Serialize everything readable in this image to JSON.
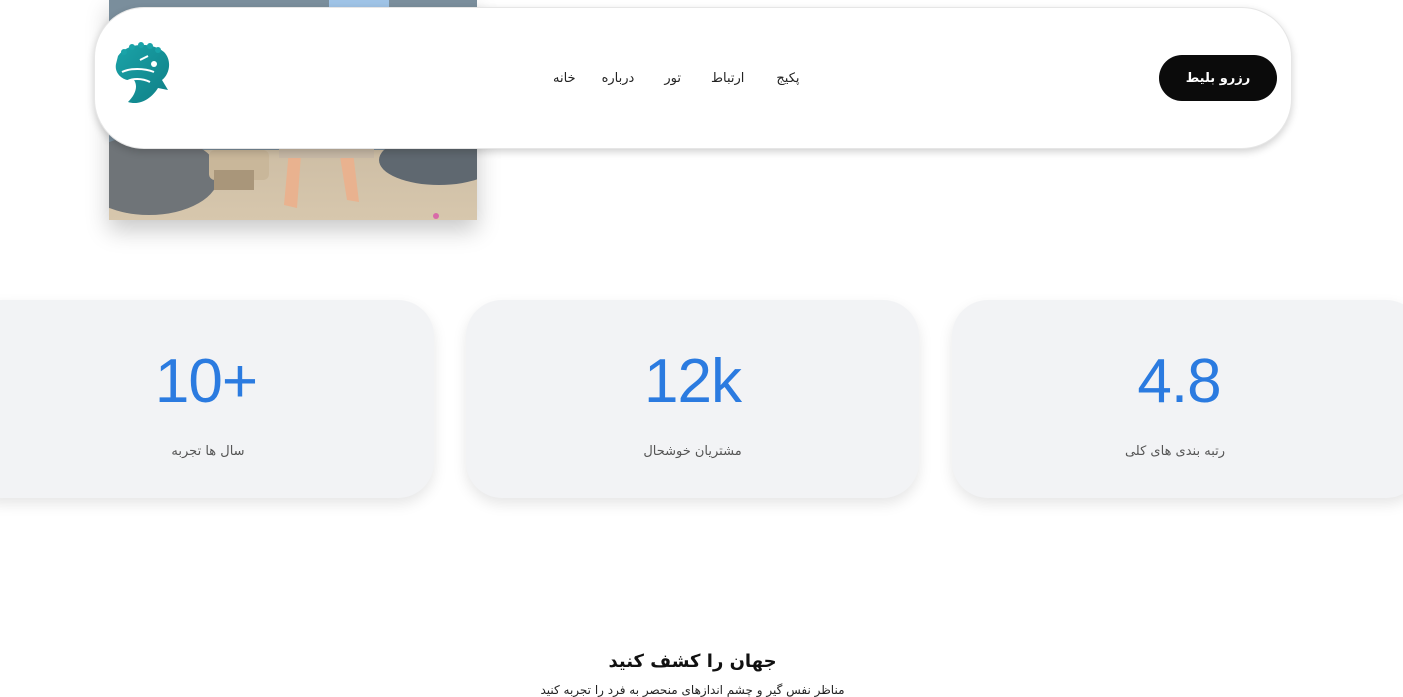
{
  "header": {
    "nav_items": [
      "خانه",
      "درباره",
      "تور",
      "ارتباط",
      "پکیج"
    ],
    "book_button": "رزرو بلیط"
  },
  "stats": [
    {
      "value": "10+",
      "label": "سال ها تجربه"
    },
    {
      "value": "12k",
      "label": "مشتریان خوشحال"
    },
    {
      "value": "4.8",
      "label": "رتبه بندی های کلی"
    }
  ],
  "explore": {
    "title": "جهان را کشف کنید",
    "subtitle": "مناظر نفس گیر و چشم اندازهای منحصر به فرد را تجربه کنید"
  },
  "colors": {
    "accent_blue": "#2b7be0",
    "button_black": "#0b0b0b",
    "card_bg": "#f2f3f5",
    "logo_teal": "#1aa3a8"
  },
  "icons": {
    "logo": "horse-logo-icon"
  }
}
